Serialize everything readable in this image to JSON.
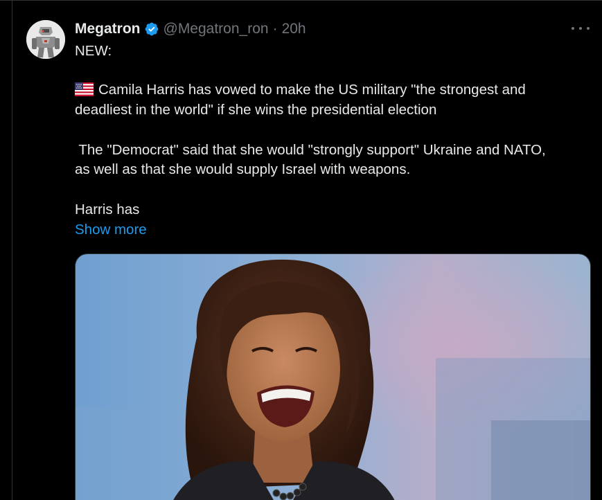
{
  "tweet": {
    "author_name": "Megatron",
    "handle": "@Megatron_ron",
    "separator": "·",
    "time": "20h",
    "lines": [
      "NEW:",
      "Camila Harris has vowed to make the US military \"the strongest and",
      "deadliest in the world\" if she wins the presidential election",
      " The \"Democrat\" said that she would \"strongly support\" Ukraine and NATO,",
      "as well as that she would supply Israel with weapons.",
      "Harris has"
    ],
    "show_more": "Show more"
  },
  "icons": {
    "avatar": "robot-avatar",
    "verified": "verified-badge-icon",
    "more": "more-horizontal-icon",
    "flag": "us-flag-icon"
  },
  "colors": {
    "background": "#000000",
    "text": "#e7e9ea",
    "secondary": "#71767b",
    "link": "#1d9bf0",
    "verified": "#1d9bf0"
  }
}
